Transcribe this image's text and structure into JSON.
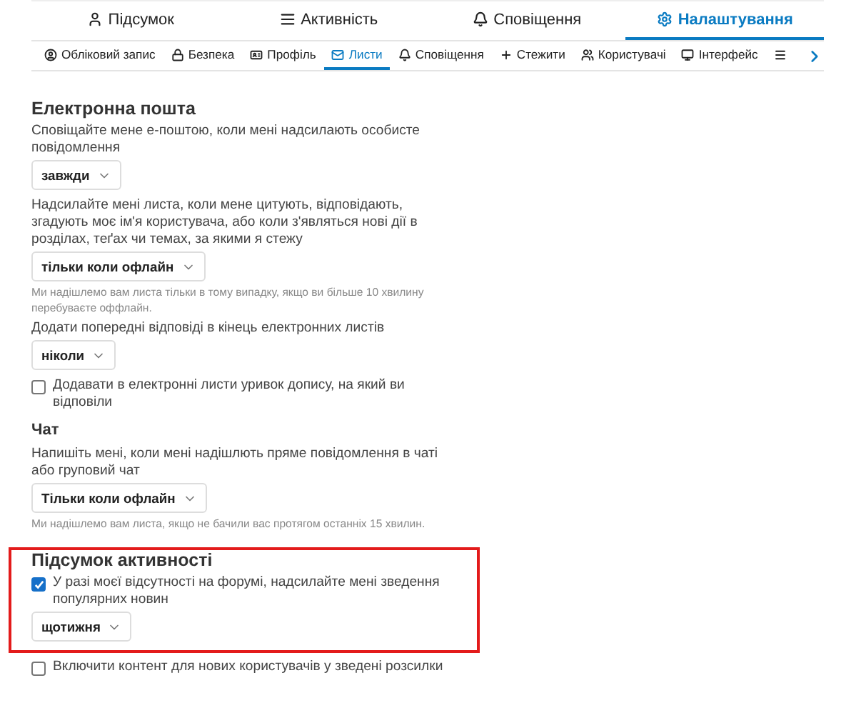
{
  "main_tabs": [
    {
      "label": "Підсумок",
      "kind": "user",
      "selected": false
    },
    {
      "label": "Активність",
      "kind": "list",
      "selected": false
    },
    {
      "label": "Сповіщення",
      "kind": "bell",
      "selected": false
    },
    {
      "label": "Налаштування",
      "kind": "gear",
      "selected": true
    }
  ],
  "sub_tabs": [
    {
      "label": "Обліковий запис",
      "kind": "account",
      "selected": false
    },
    {
      "label": "Безпека",
      "kind": "lock",
      "selected": false
    },
    {
      "label": "Профіль",
      "kind": "card",
      "selected": false
    },
    {
      "label": "Листи",
      "kind": "mail",
      "selected": true
    },
    {
      "label": "Сповіщення",
      "kind": "bell",
      "selected": false
    },
    {
      "label": "Стежити",
      "kind": "plus",
      "selected": false
    },
    {
      "label": "Користувачі",
      "kind": "users",
      "selected": false
    },
    {
      "label": "Інтерфейс",
      "kind": "monitor",
      "selected": false
    },
    {
      "kind": "menu",
      "selected": false
    }
  ],
  "sections": [
    {
      "heading": "Електронна пошта",
      "kind": "main",
      "highlighted": false,
      "items": [
        {
          "kind": "select",
          "label": "Сповіщайте мене е-поштою, коли мені надсилають особисте повідомлення",
          "value": "завжди"
        },
        {
          "kind": "select",
          "label": "Надсилайте мені листа, коли мене цитують, відповідають, згадують моє ім'я користувача, або коли з'являться нові дії в розділах, теґах чи темах, за якими я стежу",
          "value": "тільки коли офлайн",
          "hint": "Ми надішлемо вам листа тільки в тому випадку, якщо ви більше 10 хвилину перебуваєте оффлайн."
        },
        {
          "kind": "select",
          "label": "Додати попередні відповіді в кінець електронних листів",
          "value": "ніколи"
        },
        {
          "kind": "checkbox",
          "label": "Додавати в електронні листи уривок допису, на який ви відповіли",
          "checked": false
        }
      ]
    },
    {
      "heading": "Чат",
      "kind": "sub",
      "highlighted": false,
      "items": [
        {
          "kind": "select",
          "label": "Напишіть мені, коли мені надішлють пряме повідомлення в чаті або груповий чат",
          "value": "Тільки коли офлайн",
          "hint": "Ми надішлемо вам листа, якщо не бачили вас протягом останніх 15 хвилин."
        }
      ]
    },
    {
      "heading": "Підсумок активності",
      "kind": "main",
      "highlighted": true,
      "items": [
        {
          "kind": "checkbox",
          "label": "У разі моєї відсутності на форумі, надсилайте мені зведення популярних новин",
          "checked": true
        },
        {
          "kind": "select",
          "value": "щотижня"
        }
      ]
    },
    {
      "highlighted": false,
      "items": [
        {
          "kind": "checkbox",
          "label": "Включити контент для нових користувачів у зведені розсилки",
          "checked": false
        }
      ]
    }
  ]
}
